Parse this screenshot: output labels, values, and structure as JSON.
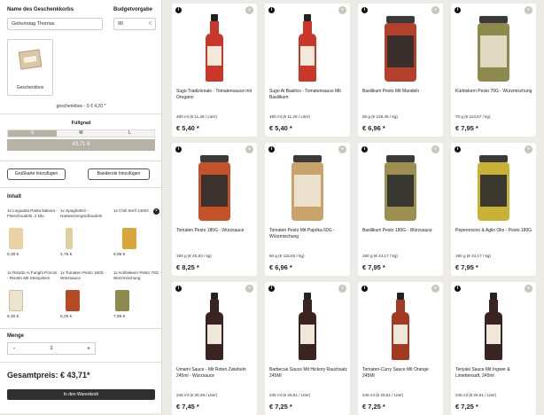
{
  "form": {
    "name_label": "Name des Geschenkkorbs",
    "name_value": "Geburtstag Thomas",
    "budget_label": "Budgetvorgabe",
    "budget_value": "90",
    "budget_currency": "€"
  },
  "box": {
    "label": "Geschenkbox",
    "price_text": "geschenkbox - S € 4,20 *"
  },
  "fill": {
    "label": "Füllgrad",
    "sizes": [
      "S",
      "M",
      "L"
    ],
    "value": "43,71 €"
  },
  "actions": {
    "greeting_card": "Grußkarte hinzufügen",
    "banderole": "Banderole hinzufügen"
  },
  "contents": {
    "label": "Inhalt",
    "items": [
      {
        "name": "1x Linguatta Pasta ltaliana - Fleischnudeln, 2 kilo",
        "price": "6,30 €",
        "color": "#e9d3a4"
      },
      {
        "name": "1x Spaghettini - Hartweizengrießnudeln",
        "price": "4,75 €",
        "color": "#e2cfa0"
      },
      {
        "name": "1x Chili Senf 140ml",
        "price": "5,95 €",
        "color": "#d9a63c"
      },
      {
        "name": "1x Risotto Ai Funghi Porcini - Risotto Mit Steinpilzen",
        "price": "6,30 €",
        "color": "#ede3cf"
      },
      {
        "name": "1x Tomaten Pesto 180G - Würzsauce",
        "price": "8,25 €",
        "color": "#b54a27"
      },
      {
        "name": "1x Kürbiskern Pesto 70G - Würzmischung",
        "price": "7,95 €",
        "color": "#8e8a4d"
      }
    ]
  },
  "quantity": {
    "label": "Menge",
    "minus": "-",
    "value": "1",
    "plus": "+"
  },
  "total": "Gesamtpreis: € 43,71*",
  "cart_button": "In den Warenkorb",
  "icons": {
    "info": "i",
    "add": "+",
    "remove": "×"
  },
  "products": [
    {
      "name": "Sugo Tradizionale - Tomatensauce mit Oregano",
      "meta": "480 ml (€ 11,28 / Liter)",
      "price": "€ 5,40 *",
      "kind": "bottle-red"
    },
    {
      "name": "Sugo Al Basilico - Tomatensauce Mit Basilikum",
      "meta": "480 ml (€ 11,28 / Liter)",
      "price": "€ 5,40 *",
      "kind": "bottle-red"
    },
    {
      "name": "Basilikum Pesto Mit Mandeln",
      "meta": "55 g (€ 126,45 / kg)",
      "price": "€ 6,96 *",
      "kind": "jar-red"
    },
    {
      "name": "Kürbiskern Pesto 70G - Würzmischung",
      "meta": "70 g (€ 113,57 / kg)",
      "price": "€ 7,95 *",
      "kind": "jar-olive"
    },
    {
      "name": "Tomaten Pesto 180G - Würzsauce",
      "meta": "180 g (€ 45,83 / kg)",
      "price": "€ 8,25 *",
      "kind": "jar-orange"
    },
    {
      "name": "Tomaten Pesto Mit Paprika 60G - Würzmischung",
      "meta": "60 g (€ 115,83 / kg)",
      "price": "€ 6,96 *",
      "kind": "jar-beige"
    },
    {
      "name": "Basilikum Pesto 180G - Würzsauce",
      "meta": "180 g (€ 44,17 / kg)",
      "price": "€ 7,95 *",
      "kind": "jar-khaki"
    },
    {
      "name": "Peperoncino & Aglio Olio - Pesto 180G",
      "meta": "180 g (€ 44,17 / kg)",
      "price": "€ 7,95 *",
      "kind": "jar-yellow"
    },
    {
      "name": "Umami Sauce - Mit Roten Zwiebeln 245ml - Würzsauce",
      "meta": "245 ml (€ 30,48 / Liter)",
      "price": "€ 7,45 *",
      "kind": "bottle-dark"
    },
    {
      "name": "Barbecue Sauce Mit Hickory Rauchsalz 245Ml",
      "meta": "245 ml (€ 29,51 / Liter)",
      "price": "€ 7,25 *",
      "kind": "bottle-dark"
    },
    {
      "name": "Tomaten-Curry Sauce Mit Orange 245Ml",
      "meta": "245 ml (€ 29,51 / Liter)",
      "price": "€ 7,25 *",
      "kind": "bottle-brick"
    },
    {
      "name": "Teriyaki Sauce Mit Ingwer & Limettensaft, 245ml",
      "meta": "245 ml (€ 29,61 / Liter)",
      "price": "€ 7,25 *",
      "kind": "bottle-dark"
    }
  ]
}
